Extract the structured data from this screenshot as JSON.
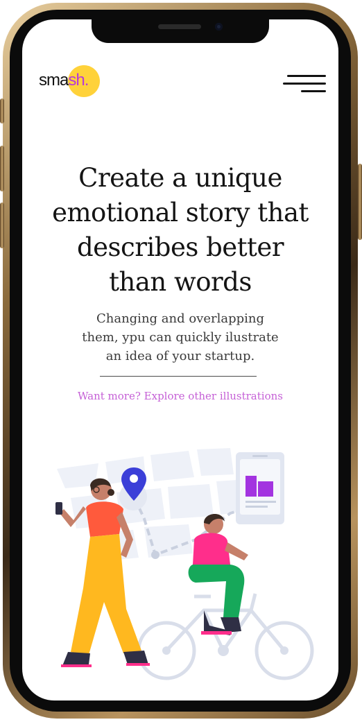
{
  "brand": {
    "logo_prefix": "sma",
    "logo_accent": "sh.",
    "accent_color": "#b73ad8",
    "dot_color": "#ffd23a"
  },
  "header": {
    "menu_icon": "hamburger-menu-icon"
  },
  "hero": {
    "headline_line1": "Create a unique",
    "headline_line2": "emotional story that",
    "headline_line3": "describes better",
    "headline_line4": "than words",
    "subtext_line1": "Changing and overlapping",
    "subtext_line2": "them, ypu can quickly ilustrate",
    "subtext_line3": "an idea of your startup.",
    "link_text": "Want more? Explore other illustrations",
    "link_color": "#c560d6"
  },
  "illustration": {
    "icons": [
      "location-pin-icon",
      "mobile-card-icon",
      "building-icon"
    ],
    "colors": {
      "pin": "#3b3fd8",
      "shirt_red": "#ff5a3c",
      "pants_yellow": "#ffb81f",
      "shirt_pink": "#ff2e8b",
      "pants_green": "#16a85a",
      "map_light": "#eef1f8",
      "building_purple": "#a334e0"
    }
  }
}
